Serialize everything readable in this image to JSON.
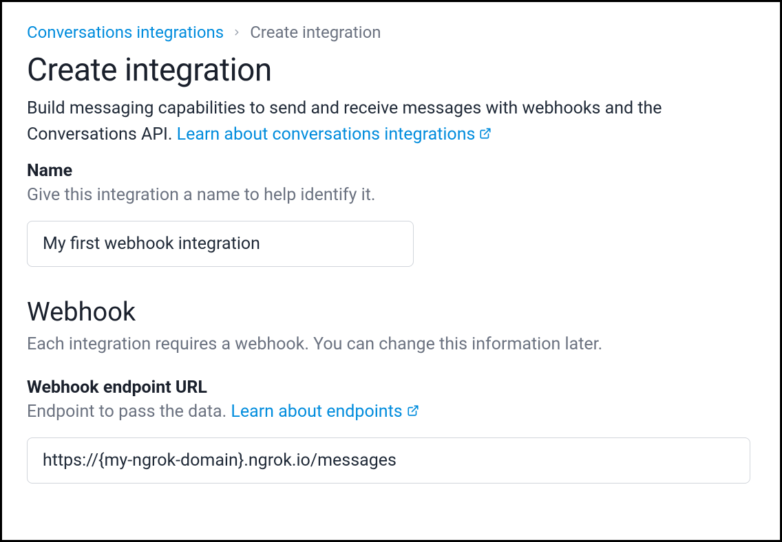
{
  "breadcrumb": {
    "parent": "Conversations integrations",
    "current": "Create integration"
  },
  "header": {
    "title": "Create integration",
    "description_prefix": "Build messaging capabilities to send and receive messages with webhooks and the Conversations API. ",
    "learn_link": "Learn about conversations integrations"
  },
  "name_field": {
    "label": "Name",
    "hint": "Give this integration a name to help identify it.",
    "value": "My first webhook integration"
  },
  "webhook_section": {
    "title": "Webhook",
    "description": "Each integration requires a webhook. You can change this information later."
  },
  "endpoint_field": {
    "label": "Webhook endpoint URL",
    "hint_prefix": "Endpoint to pass the data. ",
    "learn_link": "Learn about endpoints",
    "value": "https://{my-ngrok-domain}.ngrok.io/messages"
  }
}
